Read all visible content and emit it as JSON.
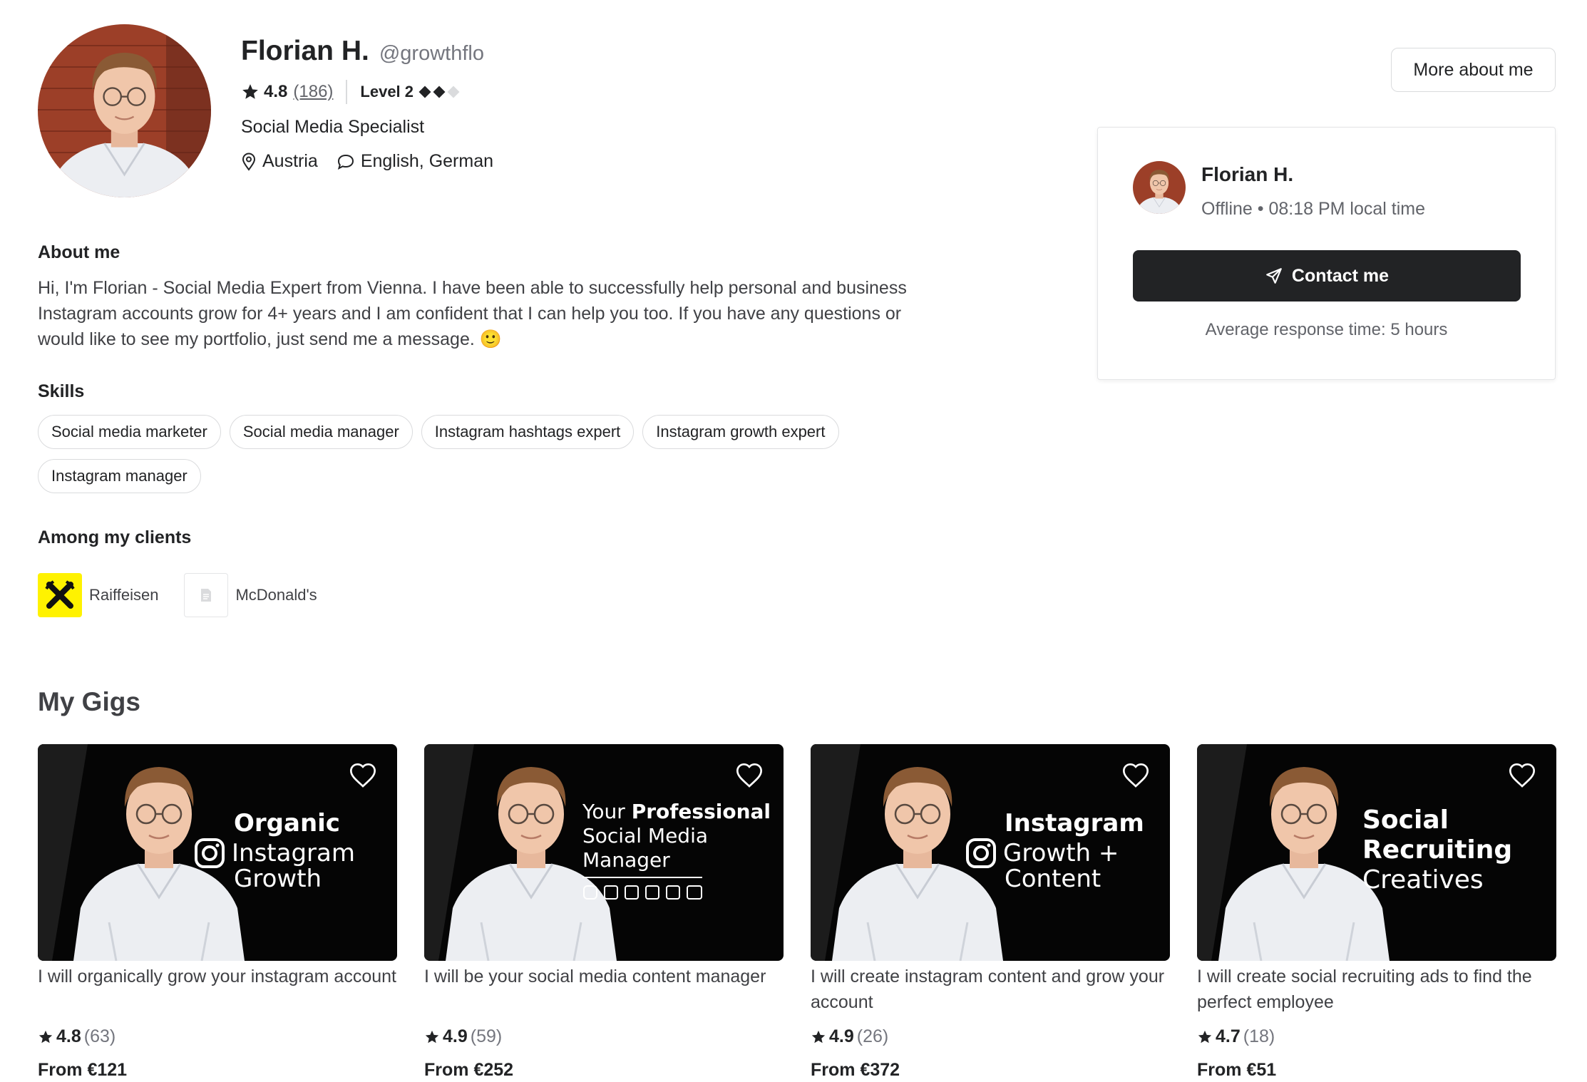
{
  "profile": {
    "name": "Florian H.",
    "handle": "@growthflo",
    "rating": "4.8",
    "review_count": "(186)",
    "level": "Level 2",
    "title": "Social Media Specialist",
    "location": "Austria",
    "languages": "English, German",
    "more_button": "More about me"
  },
  "contact_card": {
    "name": "Florian H.",
    "status": "Offline • 08:18 PM local time",
    "contact_button": "Contact me",
    "response_time": "Average response time: 5 hours"
  },
  "about": {
    "heading": "About me",
    "text": "Hi, I'm Florian - Social Media Expert from Vienna. I have been able to successfully help personal and business Instagram accounts grow for 4+ years and I am confident that I can help you too. If you have any questions or would like to see my portfolio, just send me a message. 🙂"
  },
  "skills": {
    "heading": "Skills",
    "items": [
      "Social media marketer",
      "Social media manager",
      "Instagram hashtags expert",
      "Instagram growth expert",
      "Instagram manager"
    ]
  },
  "clients": {
    "heading": "Among my clients",
    "items": [
      {
        "name": "Raiffeisen",
        "color": "#fff200"
      },
      {
        "name": "McDonald's"
      }
    ]
  },
  "gigs": {
    "heading": "My Gigs",
    "items": [
      {
        "image_text": [
          "Organic",
          "Instagram",
          "Growth"
        ],
        "description": "I will organically grow your instagram account",
        "rating": "4.8",
        "count": "(63)",
        "price": "From €121"
      },
      {
        "image_text": [
          "Your",
          "Professional",
          "Social Media",
          "Manager"
        ],
        "description": "I will be your social media content manager",
        "rating": "4.9",
        "count": "(59)",
        "price": "From €252"
      },
      {
        "image_text": [
          "Instagram",
          "Growth +",
          "Content"
        ],
        "description": "I will create instagram content and grow your account",
        "rating": "4.9",
        "count": "(26)",
        "price": "From €372"
      },
      {
        "image_text": [
          "Social",
          "Recruiting",
          "Creatives"
        ],
        "description": "I will create social recruiting ads to find the perfect employee",
        "rating": "4.7",
        "count": "(18)",
        "price": "From €51"
      }
    ]
  },
  "colors": {
    "primary_text": "#222325",
    "secondary_text": "#62646a",
    "button_dark": "#222325",
    "border": "#dadbdd"
  }
}
